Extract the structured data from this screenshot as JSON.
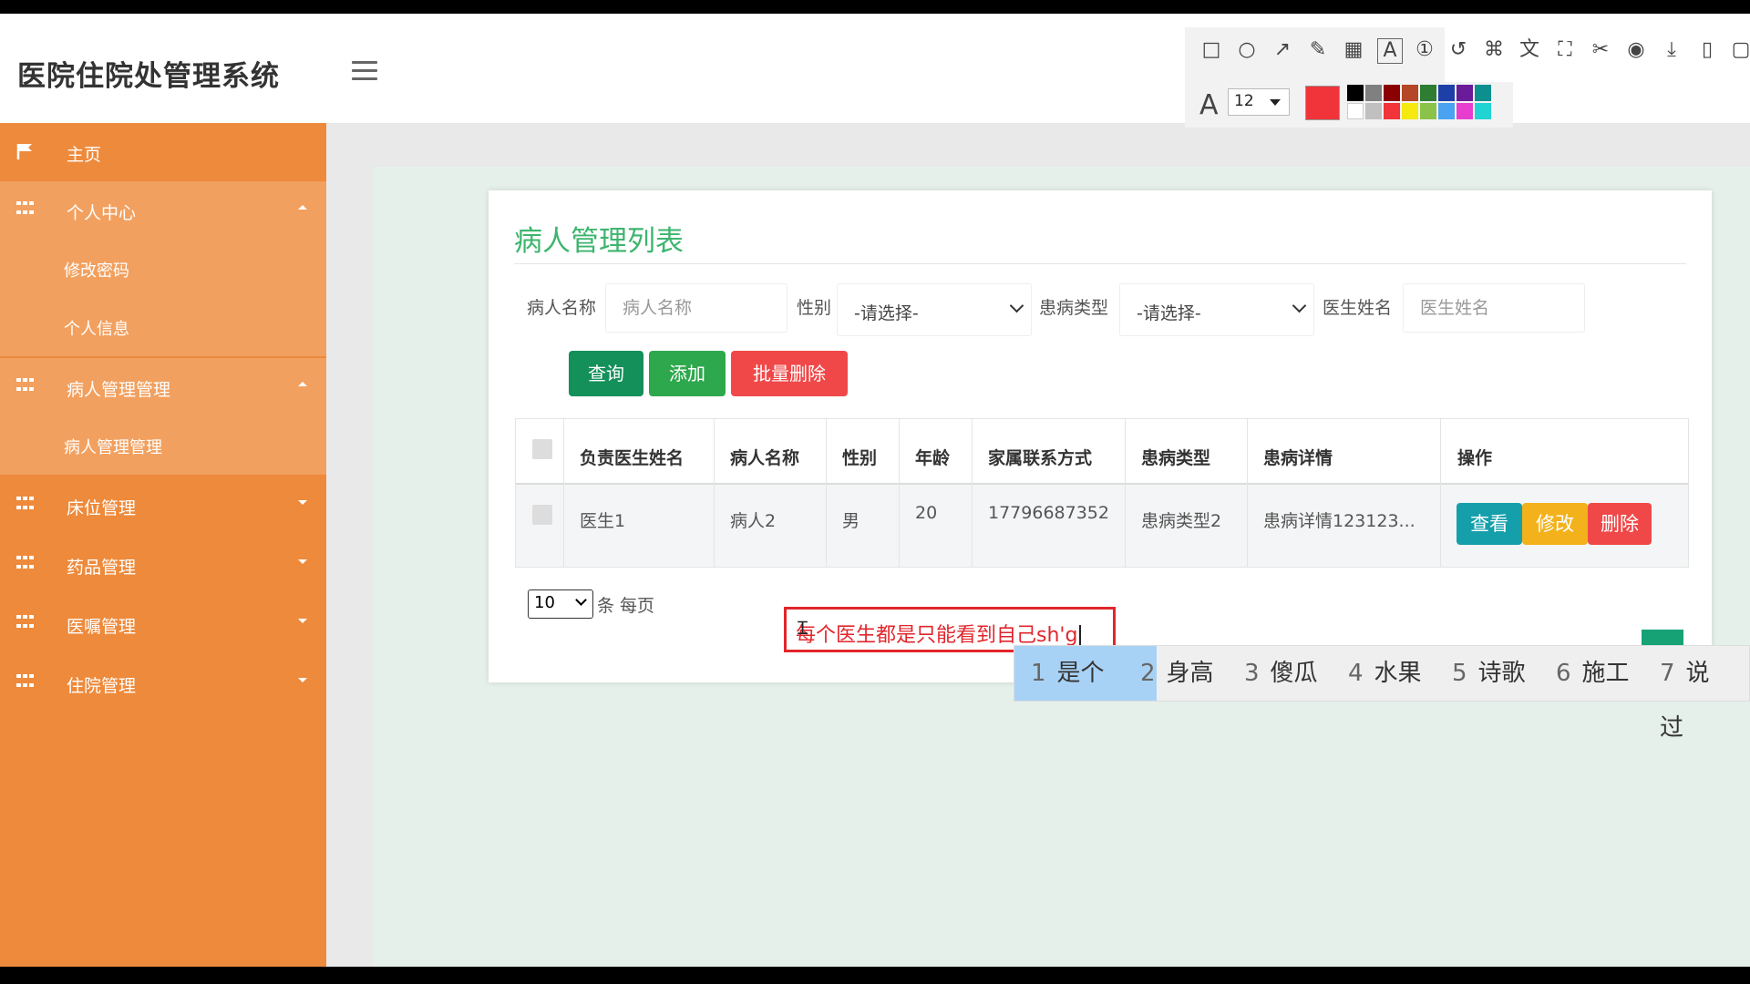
{
  "app": {
    "title": "医院住院处管理系统"
  },
  "sidebar": {
    "items": [
      {
        "label": "主页",
        "icon": "flag-icon"
      },
      {
        "label": "个人中心",
        "icon": "grid-icon",
        "expanded": true,
        "children": [
          "修改密码",
          "个人信息"
        ]
      },
      {
        "label": "病人管理管理",
        "icon": "grid-icon",
        "expanded": true,
        "children": [
          "病人管理管理"
        ]
      },
      {
        "label": "床位管理",
        "icon": "grid-icon",
        "expanded": false
      },
      {
        "label": "药品管理",
        "icon": "grid-icon",
        "expanded": false
      },
      {
        "label": "医嘱管理",
        "icon": "grid-icon",
        "expanded": false
      },
      {
        "label": "住院管理",
        "icon": "grid-icon",
        "expanded": false
      }
    ]
  },
  "page": {
    "title": "病人管理列表",
    "filters": {
      "patient_name_label": "病人名称",
      "patient_name_placeholder": "病人名称",
      "gender_label": "性别",
      "gender_value": "-请选择-",
      "disease_type_label": "患病类型",
      "disease_type_value": "-请选择-",
      "doctor_name_label": "医生姓名",
      "doctor_name_placeholder": "医生姓名"
    },
    "buttons": {
      "query": "查询",
      "add": "添加",
      "batch_delete": "批量删除"
    },
    "table": {
      "headers": [
        "负责医生姓名",
        "病人名称",
        "性别",
        "年龄",
        "家属联系方式",
        "患病类型",
        "患病详情",
        "操作"
      ],
      "rows": [
        {
          "doctor": "医生1",
          "patient": "病人2",
          "gender": "男",
          "age": "20",
          "phone": "17796687352",
          "disease_type": "患病类型2",
          "disease_detail": "患病详情123123...",
          "actions": [
            "查看",
            "修改",
            "删除"
          ]
        }
      ]
    },
    "pagination": {
      "page_size": "10",
      "per_page_text": "条 每页"
    }
  },
  "annotation": {
    "text": "每个医生都是只能看到自己sh'g"
  },
  "ime": {
    "candidates": [
      {
        "num": "1",
        "text": "是个",
        "selected": true
      },
      {
        "num": "2",
        "text": "身高"
      },
      {
        "num": "3",
        "text": "傻瓜"
      },
      {
        "num": "4",
        "text": "水果"
      },
      {
        "num": "5",
        "text": "诗歌"
      },
      {
        "num": "6",
        "text": "施工"
      },
      {
        "num": "7",
        "text": "说过"
      }
    ]
  },
  "capture_toolbar": {
    "tools": [
      "rectangle-icon",
      "ellipse-icon",
      "arrow-icon",
      "pencil-icon",
      "mosaic-icon",
      "text-icon",
      "number-icon",
      "undo-icon",
      "pin-icon",
      "translate-icon",
      "ocr-icon",
      "pin2-icon",
      "record-icon",
      "download-icon",
      "save-icon",
      "copy-icon"
    ],
    "font_size": "12",
    "current_color": "#f0343a",
    "palette": [
      "#000000",
      "#808080",
      "#8b0000",
      "#b34726",
      "#2e7d32",
      "#1e3fa8",
      "#6a1b9a",
      "#0b8f8f",
      "#ffffff",
      "#c0c0c0",
      "#f0343a",
      "#f5e90f",
      "#8bc34a",
      "#4aa3f0",
      "#e83ecf",
      "#22d3d3"
    ]
  },
  "colors": {
    "sidebar_bg": "#ee8a3b",
    "sidebar_sub_bg": "#f2a05f",
    "accent_green": "#3db56e",
    "btn_query": "#14905a",
    "btn_add": "#2ea84c",
    "btn_delete": "#f04848",
    "btn_view": "#159fab",
    "btn_edit": "#f3b21b"
  }
}
